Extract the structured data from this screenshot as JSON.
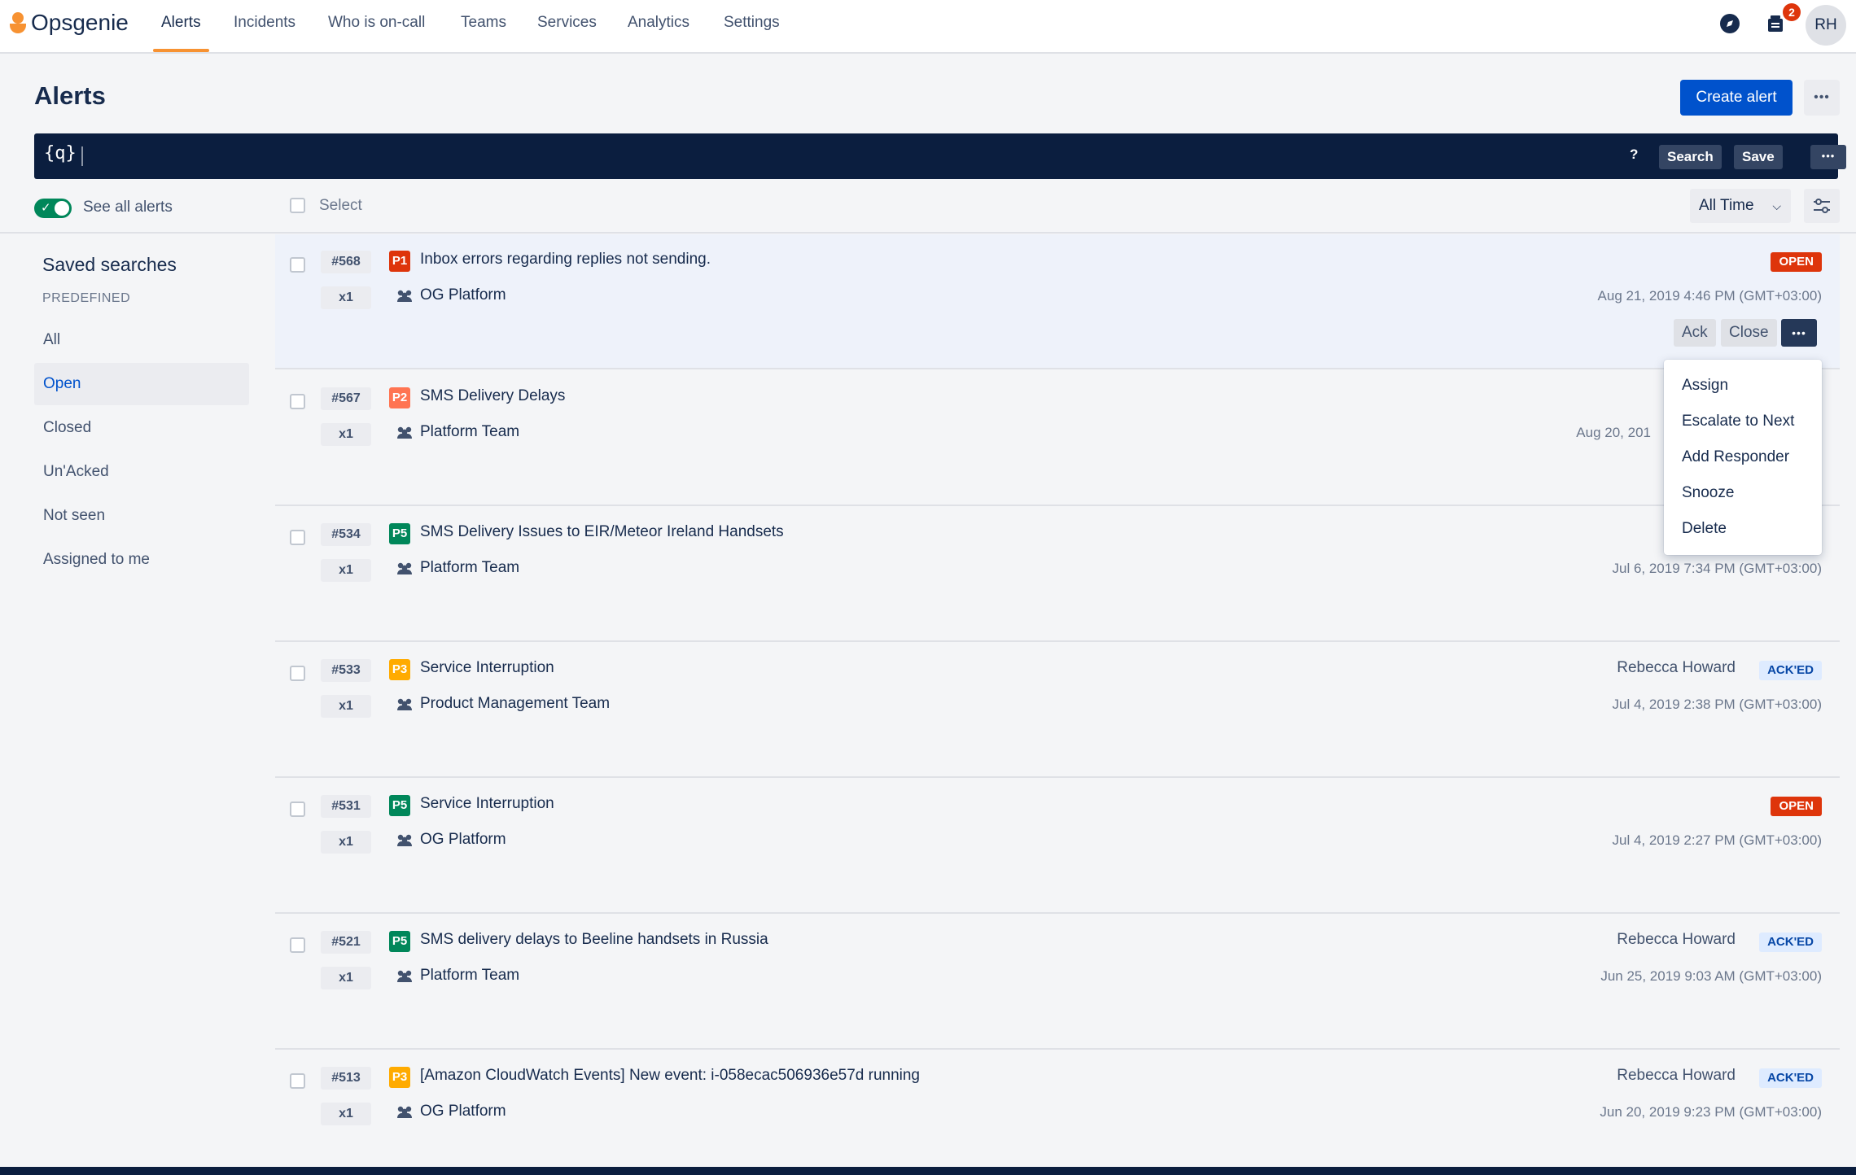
{
  "app": {
    "name": "Opsgenie"
  },
  "nav": {
    "items": [
      {
        "label": "Alerts",
        "active": true
      },
      {
        "label": "Incidents"
      },
      {
        "label": "Who is on-call"
      },
      {
        "label": "Teams"
      },
      {
        "label": "Services"
      },
      {
        "label": "Analytics"
      },
      {
        "label": "Settings"
      }
    ],
    "notifications_count": "2",
    "avatar_initials": "RH"
  },
  "header": {
    "title": "Alerts",
    "create_label": "Create alert"
  },
  "search": {
    "icon_text": "{q}",
    "value": "",
    "help_label": "?",
    "search_label": "Search",
    "save_label": "Save"
  },
  "toolbar": {
    "toggle_label": "See all alerts",
    "select_label": "Select",
    "time_filter": "All Time"
  },
  "sidebar": {
    "title": "Saved searches",
    "category": "PREDEFINED",
    "items": [
      {
        "label": "All"
      },
      {
        "label": "Open",
        "active": true
      },
      {
        "label": "Closed"
      },
      {
        "label": "Un'Acked"
      },
      {
        "label": "Not seen"
      },
      {
        "label": "Assigned to me"
      }
    ]
  },
  "alerts": [
    {
      "id": "#568",
      "count": "x1",
      "priority": "P1",
      "message": "Inbox errors regarding replies not sending.",
      "team": "OG Platform",
      "status": "OPEN",
      "owner": "",
      "time": "Aug 21, 2019 4:46 PM (GMT+03:00)"
    },
    {
      "id": "#567",
      "count": "x1",
      "priority": "P2",
      "message": "SMS Delivery Delays",
      "team": "Platform Team",
      "status": "",
      "owner": "",
      "time": "Aug 20, 201"
    },
    {
      "id": "#534",
      "count": "x1",
      "priority": "P5",
      "message": "SMS Delivery Issues to EIR/Meteor Ireland Handsets",
      "team": "Platform Team",
      "status": "",
      "owner": "",
      "time": "Jul 6, 2019 7:34 PM (GMT+03:00)"
    },
    {
      "id": "#533",
      "count": "x1",
      "priority": "P3",
      "message": "Service Interruption",
      "team": "Product Management Team",
      "status": "ACK'ED",
      "owner": "Rebecca Howard",
      "time": "Jul 4, 2019 2:38 PM (GMT+03:00)"
    },
    {
      "id": "#531",
      "count": "x1",
      "priority": "P5",
      "message": "Service Interruption",
      "team": "OG Platform",
      "status": "OPEN",
      "owner": "",
      "time": "Jul 4, 2019 2:27 PM (GMT+03:00)"
    },
    {
      "id": "#521",
      "count": "x1",
      "priority": "P5",
      "message": "SMS delivery delays to Beeline handsets in Russia",
      "team": "Platform Team",
      "status": "ACK'ED",
      "owner": "Rebecca Howard",
      "time": "Jun 25, 2019 9:03 AM (GMT+03:00)"
    },
    {
      "id": "#513",
      "count": "x1",
      "priority": "P3",
      "message": "[Amazon CloudWatch Events] New event: i-058ecac506936e57d running",
      "team": "OG Platform",
      "status": "ACK'ED",
      "owner": "Rebecca Howard",
      "time": "Jun 20, 2019 9:23 PM (GMT+03:00)"
    }
  ],
  "row_actions": {
    "ack_label": "Ack",
    "close_label": "Close"
  },
  "menu": {
    "items": [
      {
        "label": "Assign"
      },
      {
        "label": "Escalate to Next"
      },
      {
        "label": "Add Responder"
      },
      {
        "label": "Snooze"
      },
      {
        "label": "Delete"
      }
    ]
  },
  "colors": {
    "brand": "#f79232",
    "primary": "#0052cc",
    "P1": "#de350b",
    "P2": "#ff7452",
    "P3": "#ffab00",
    "P5": "#00875a",
    "open": "#de350b",
    "acked_bg": "#deebff"
  }
}
